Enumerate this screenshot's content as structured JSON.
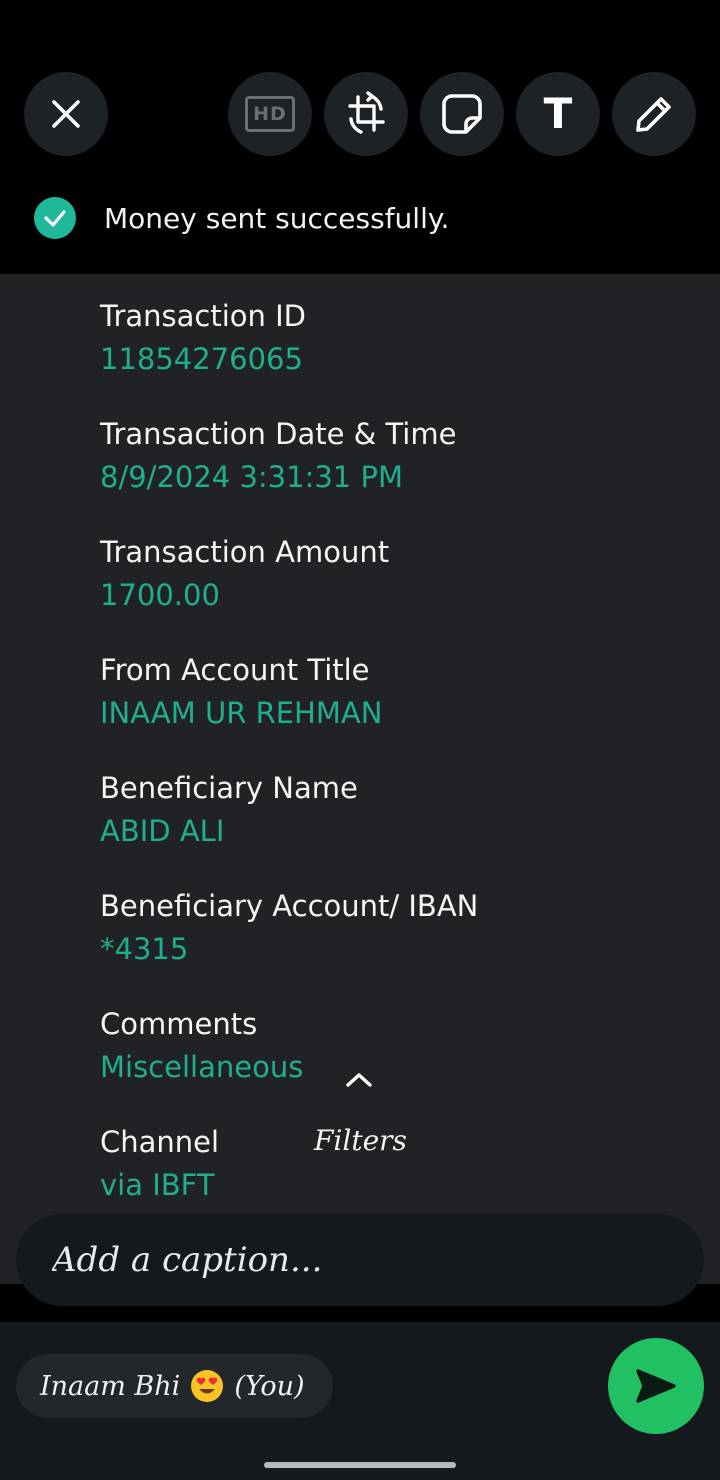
{
  "toolbar": {
    "close_icon": "close-icon",
    "hd_label": "HD",
    "crop_icon": "crop-rotate-icon",
    "sticker_icon": "sticker-icon",
    "text_label": "T",
    "draw_icon": "pencil-icon"
  },
  "receipt": {
    "status_text": "Money sent successfully.",
    "fields": [
      {
        "label": "Transaction ID",
        "value": "11854276065"
      },
      {
        "label": "Transaction Date & Time",
        "value": "8/9/2024 3:31:31 PM"
      },
      {
        "label": "Transaction Amount",
        "value": "1700.00"
      },
      {
        "label": "From Account Title",
        "value": "INAAM UR REHMAN"
      },
      {
        "label": "Beneficiary Name",
        "value": "ABID ALI"
      },
      {
        "label": "Beneficiary Account/ IBAN",
        "value": "*4315"
      },
      {
        "label": "Comments",
        "value": "Miscellaneous"
      },
      {
        "label": "Channel",
        "value": "via IBFT"
      }
    ]
  },
  "filters": {
    "label": "Filters"
  },
  "caption": {
    "placeholder": "Add a caption..."
  },
  "recipient": {
    "name": "Inaam Bhi",
    "suffix": "(You)"
  },
  "colors": {
    "accent_green": "#1fae8e",
    "send_green": "#21c063",
    "check_green": "#1fb898"
  }
}
